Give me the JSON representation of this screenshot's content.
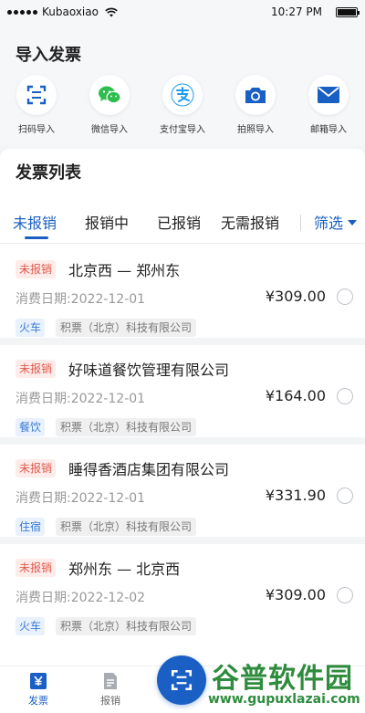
{
  "status_bar": {
    "carrier": "Kubaoxiao",
    "time": "10:27 PM"
  },
  "import_section": {
    "title": "导入发票",
    "items": [
      {
        "label": "扫码导入",
        "icon": "scan-icon"
      },
      {
        "label": "微信导入",
        "icon": "wechat-icon"
      },
      {
        "label": "支付宝导入",
        "icon": "alipay-icon"
      },
      {
        "label": "拍照导入",
        "icon": "camera-icon"
      },
      {
        "label": "邮箱导入",
        "icon": "mail-icon"
      }
    ]
  },
  "list_section": {
    "title": "发票列表",
    "tabs": [
      "未报销",
      "报销中",
      "已报销",
      "无需报销"
    ],
    "active_tab": "未报销",
    "filter_label": "筛选"
  },
  "invoices": [
    {
      "status": "未报销",
      "title": "北京西 — 郑州东",
      "date": "消费日期:2022-12-01",
      "amount": "¥309.00",
      "category": "火车",
      "company": "积票（北京）科技有限公司"
    },
    {
      "status": "未报销",
      "title": "好味道餐饮管理有限公司",
      "date": "消费日期:2022-12-01",
      "amount": "¥164.00",
      "category": "餐饮",
      "company": "积票（北京）科技有限公司"
    },
    {
      "status": "未报销",
      "title": "睡得香酒店集团有限公司",
      "date": "消费日期:2022-12-01",
      "amount": "¥331.90",
      "category": "住宿",
      "company": "积票（北京）科技有限公司"
    },
    {
      "status": "未报销",
      "title": "郑州东 — 北京西",
      "date": "消费日期:2022-12-02",
      "amount": "¥309.00",
      "category": "火车",
      "company": "积票（北京）科技有限公司"
    }
  ],
  "bottom_nav": {
    "items": [
      {
        "label": "发票",
        "icon": "yen-icon",
        "active": true
      },
      {
        "label": "报销",
        "icon": "document-icon",
        "active": false
      }
    ]
  },
  "watermark": {
    "line1": "谷普软件园",
    "line2": "www.gupuxlazai.com"
  },
  "colors": {
    "accent": "#1a5fc4",
    "status_red": "#e05a4b",
    "category_blue": "#3b7ad6"
  }
}
